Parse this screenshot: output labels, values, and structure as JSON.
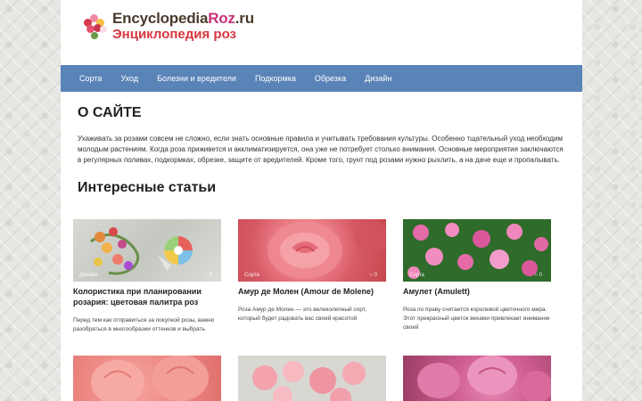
{
  "logo": {
    "part1": "Encyclopedia",
    "part2": "Roz",
    "part3": ".ru",
    "ru": "Энциклопедия роз"
  },
  "nav": [
    "Сорта",
    "Уход",
    "Болезни и вредители",
    "Подкормка",
    "Обрезка",
    "Дизайн"
  ],
  "about": {
    "title": "О САЙТЕ",
    "text": "Ухаживать за розами совсем не сложно, если знать основные правила и учитывать требования культуры. Особенно тщательный уход необходим молодым растениям. Когда роза приживется и акклиматизируется, она уже не потребует столько внимания. Основные мероприятия заключаются в регулярных поливах, подкормках, обрезке, защите от вредителей. Кроме того, грунт под розами нужно рыхлить, а на даче еще и пропалывать."
  },
  "articles_title": "Интересные статьи",
  "articles": [
    {
      "category": "Дизайн",
      "comments": "0",
      "title": "Колористика при планировании розария: цветовая палитра роз",
      "text": "Перед тем как отправиться за покупкой розы, важно разобраться в многообразии оттенков и выбрать"
    },
    {
      "category": "Сорта",
      "comments": "0",
      "title": "Амур де Молен (Amour de Molene)",
      "text": "Роза Амур де Молен — это великолепный сорт, который будет радовать вас своей красотой"
    },
    {
      "category": "Сорта",
      "comments": "0",
      "title": "Амулет (Amulett)",
      "text": "Роза по праву считается королевой цветочного мира. Этот прекрасный цветок веками привлекает внимание своей"
    },
    {
      "category": "",
      "comments": "",
      "title": "",
      "text": ""
    },
    {
      "category": "",
      "comments": "",
      "title": "",
      "text": ""
    },
    {
      "category": "",
      "comments": "",
      "title": "",
      "text": ""
    }
  ]
}
